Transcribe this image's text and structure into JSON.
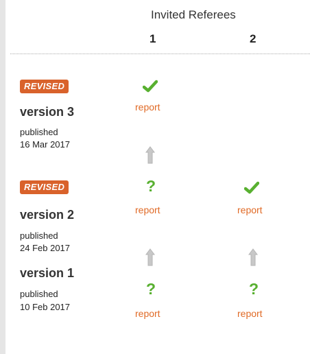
{
  "header": {
    "title": "Invited Referees",
    "referee1": "1",
    "referee2": "2"
  },
  "versions": [
    {
      "badge": "REVISED",
      "label": "version 3",
      "published_label": "published",
      "date": "16 Mar 2017",
      "referee1": {
        "status": "approved",
        "status_icon": "check-icon",
        "report_label": "report"
      }
    },
    {
      "badge": "REVISED",
      "label": "version 2",
      "published_label": "published",
      "date": "24 Feb 2017",
      "referee1": {
        "status": "approved-with-reservations",
        "status_icon": "question-icon",
        "symbol": "?",
        "report_label": "report"
      },
      "referee2": {
        "status": "approved",
        "status_icon": "check-icon",
        "report_label": "report"
      }
    },
    {
      "label": "version 1",
      "published_label": "published",
      "date": "10 Feb 2017",
      "referee1": {
        "status": "approved-with-reservations",
        "status_icon": "question-icon",
        "symbol": "?",
        "report_label": "report"
      },
      "referee2": {
        "status": "approved-with-reservations",
        "status_icon": "question-icon",
        "symbol": "?",
        "report_label": "report"
      }
    }
  ],
  "colors": {
    "badge": "#d9622b",
    "report_link": "#e06a26",
    "status_green": "#58b030",
    "arrow_gray": "#c8c8c8"
  }
}
